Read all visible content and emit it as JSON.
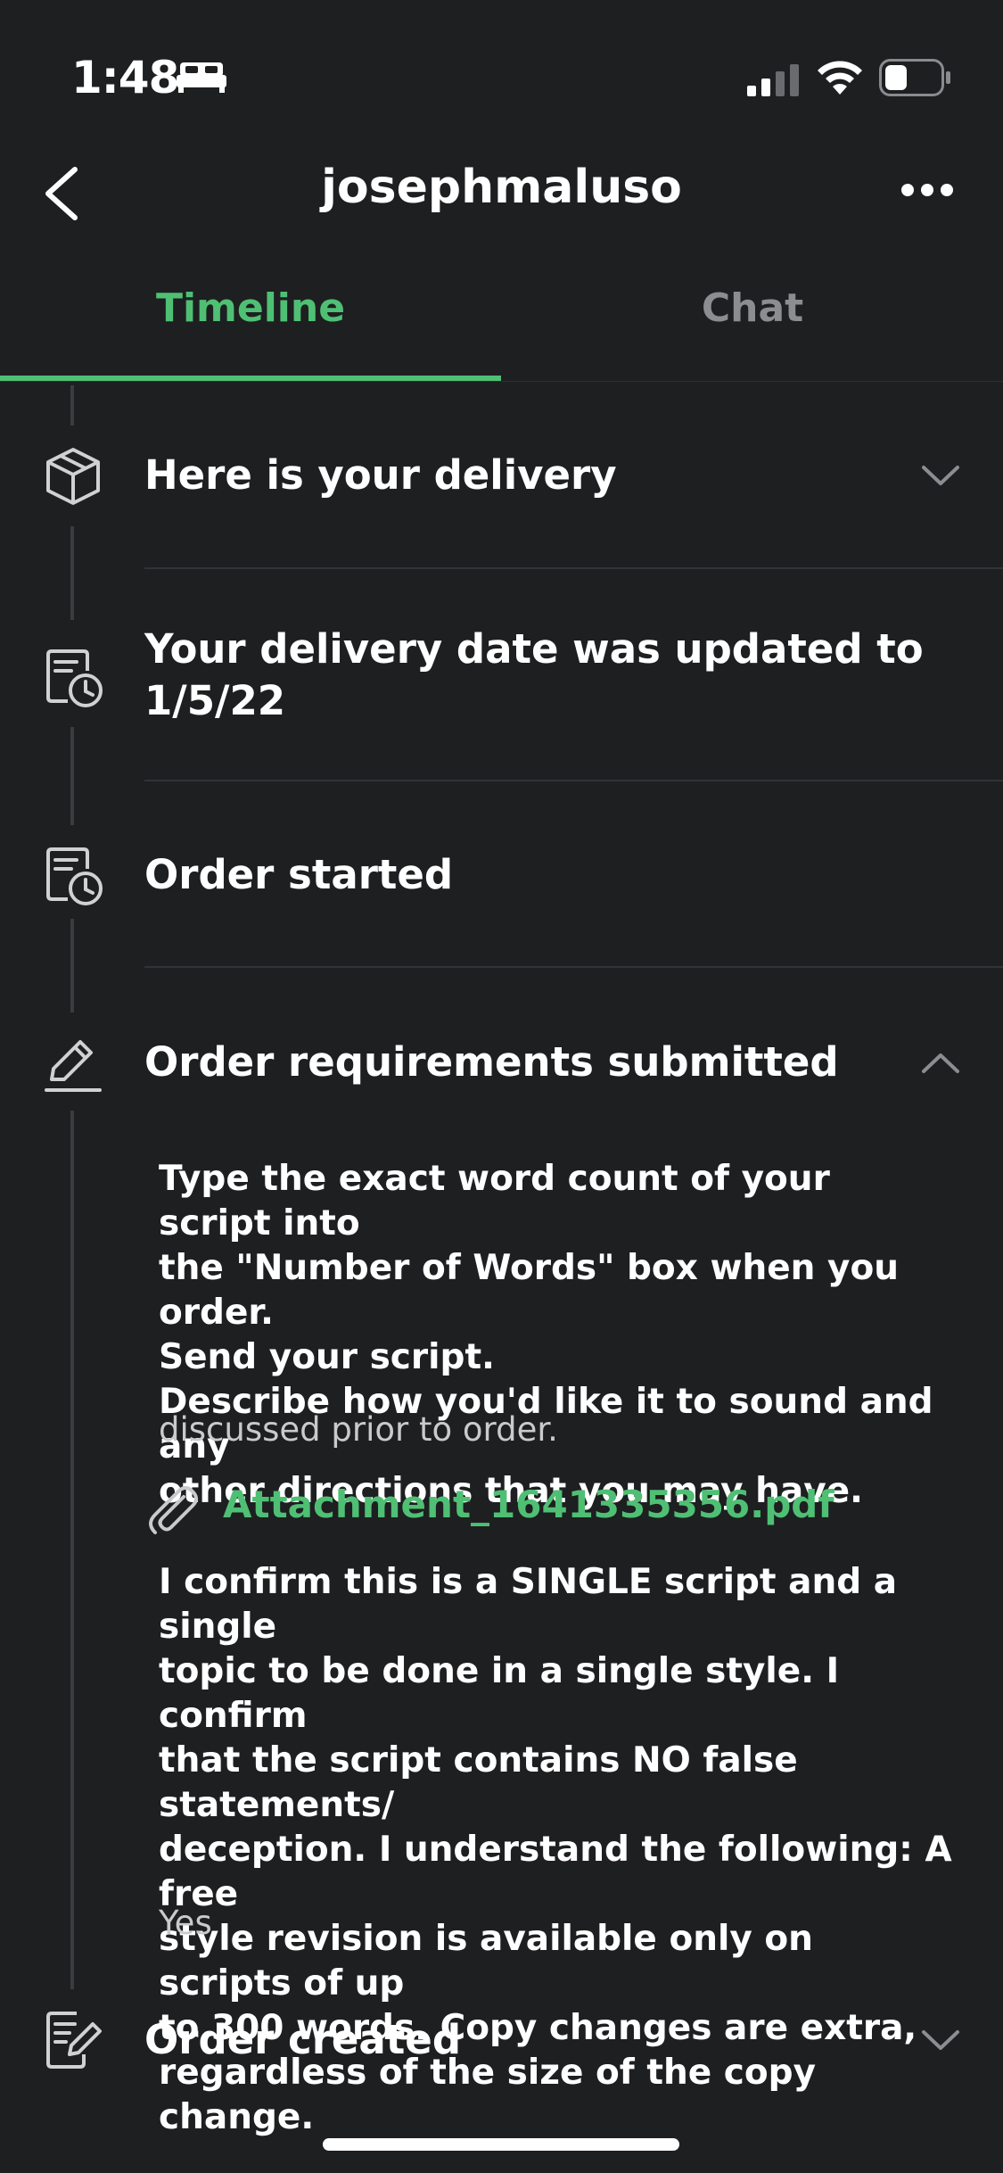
{
  "status_bar": {
    "time": "1:48"
  },
  "header": {
    "title": "josephmaluso"
  },
  "tabs": [
    {
      "label": "Timeline",
      "active": true
    },
    {
      "label": "Chat",
      "active": false
    }
  ],
  "colors": {
    "accent": "#4fbf74",
    "background": "#1e1f21",
    "muted": "#8b8d90"
  },
  "timeline": [
    {
      "icon": "package-icon",
      "title": "Here is your delivery",
      "expanded": false
    },
    {
      "icon": "calendar-clock-icon",
      "title_line1": "Your delivery date was updated to",
      "title_line2": "1/5/22"
    },
    {
      "icon": "calendar-clock-icon",
      "title": "Order started"
    },
    {
      "icon": "pencil-icon",
      "title": "Order requirements submitted",
      "expanded": true
    },
    {
      "icon": "edit-note-icon",
      "title": "Order created",
      "expanded": false
    }
  ],
  "requirements": {
    "q1_lines": [
      "Type the exact word count of your script into",
      "the \"Number of Words\" box when you order.",
      "Send your script.",
      "Describe how you'd like it to sound and any",
      "other directions that you may have."
    ],
    "a1": "discussed prior to order.",
    "attachment": "Attachment_1641335356.pdf",
    "q2_lines": [
      "I confirm this is a SINGLE script and a single",
      "topic to be done in a single style. I confirm",
      "that the script contains NO false statements/",
      "deception. I understand the following: A free",
      "style revision is available only on scripts of up",
      "to 300 words. Copy changes are extra,",
      "regardless of the size of the copy change."
    ],
    "a2": "Yes"
  }
}
